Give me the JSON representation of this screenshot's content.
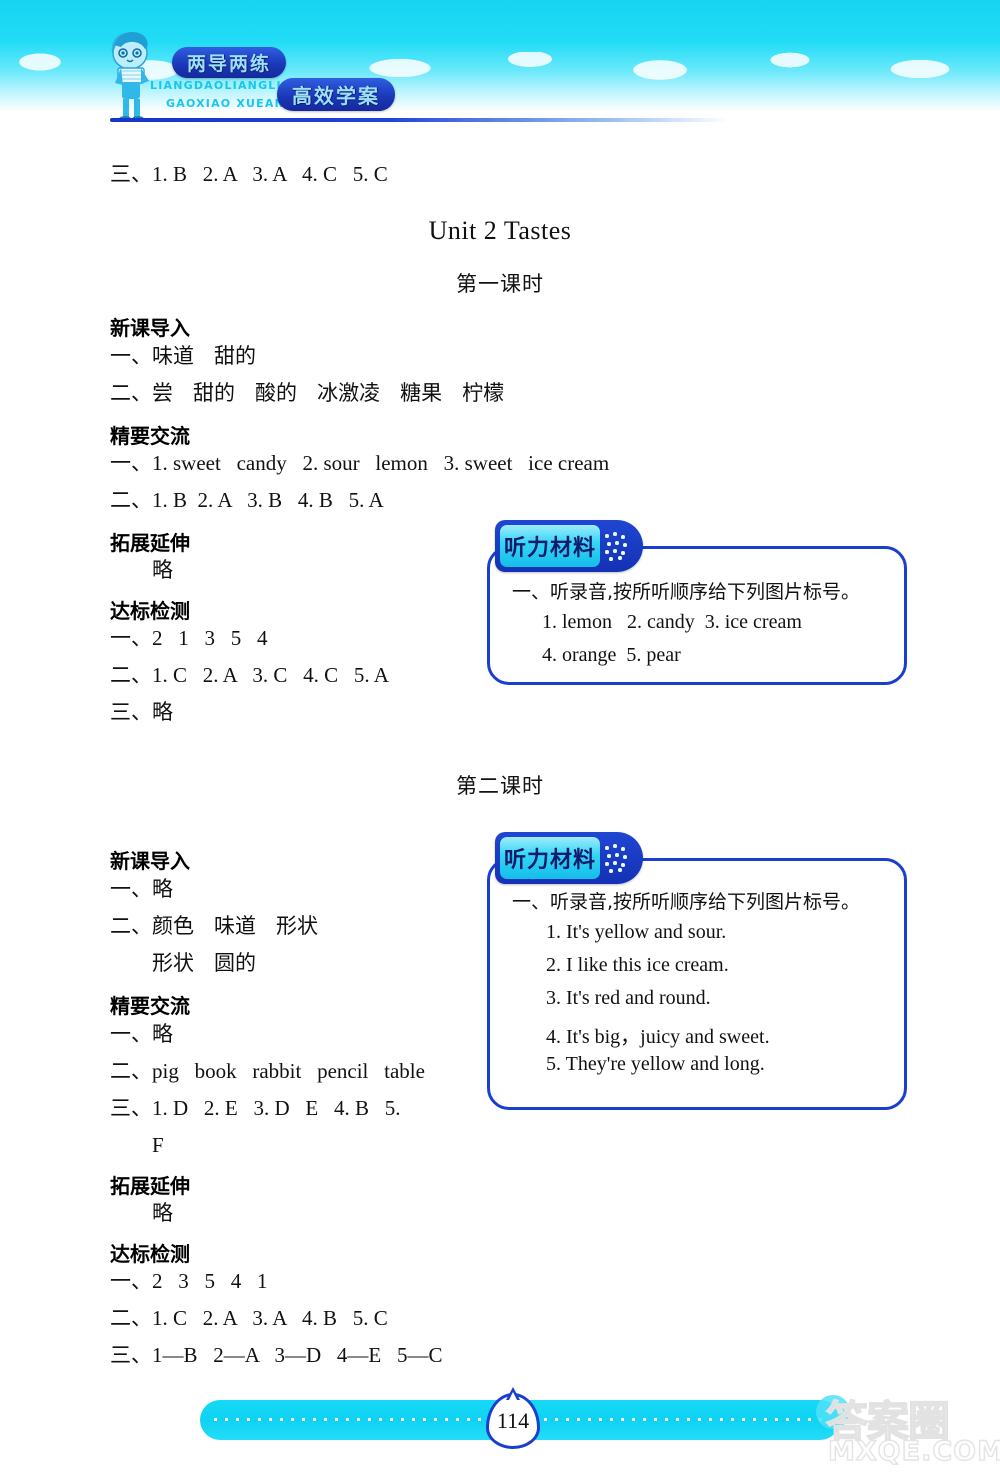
{
  "header": {
    "logo_line1": "两导两练",
    "logo_line2": "高效学案",
    "logo_pinyin1": "LIANGDAOLIANGLIAN",
    "logo_pinyin2": "GAOXIAO  XUEAN",
    "accent_blue": "#1a3fd0",
    "accent_cyan": "#17d9f6"
  },
  "content": {
    "prev_answer_line": "三、1. B   2. A   3. A   4. C   5. C",
    "unit_title": "Unit 2 Tastes",
    "lesson1_title": "第一课时",
    "lesson2_title": "第二课时",
    "section_intro": "新课导入",
    "section_communicate": "精要交流",
    "section_extend": "拓展延伸",
    "section_test": "达标检测",
    "omitted": "略"
  },
  "lesson1": {
    "intro": [
      "一、味道   甜的",
      "二、尝   甜的   酸的   冰激凌   糖果   柠檬"
    ],
    "communicate": [
      "一、1. sweet   candy   2. sour   lemon   3. sweet   ice cream",
      "二、1. B  2. A   3. B   4. B   5. A"
    ],
    "extend": "略",
    "test": [
      "一、2   1   3   5   4",
      "二、1. C   2. A   3. C   4. C   5. A",
      "三、略"
    ]
  },
  "lesson2": {
    "intro": [
      "一、略",
      "二、颜色   味道   形状",
      "形状   圆的"
    ],
    "communicate": [
      "一、略",
      "二、pig   book   rabbit   pencil   table",
      "三、1. D   2. E   3. D   E   4. B   5.",
      "F"
    ],
    "extend": "略",
    "test": [
      "一、2   3   5   4   1",
      "二、1. C   2. A   3. A   4. B   5. C",
      "三、1—B   2—A   3—D   4—E   5—C"
    ]
  },
  "listening_box_1": {
    "tab_label": "听力材料",
    "heading": "一、听录音,按所听顺序给下列图片标号。",
    "items": [
      "1. lemon   2. candy  3. ice cream",
      "4. orange  5. pear"
    ]
  },
  "listening_box_2": {
    "tab_label": "听力材料",
    "heading": "一、听录音,按所听顺序给下列图片标号。",
    "items": [
      "1. It's yellow and sour.",
      "2. I like this ice cream.",
      "3. It's red and round.",
      "4. It's big，juicy and sweet.",
      "5. They're yellow and long."
    ]
  },
  "footer": {
    "page_number": "114",
    "watermark_cn": "答案圈",
    "watermark_url": "MXQE.COM"
  }
}
